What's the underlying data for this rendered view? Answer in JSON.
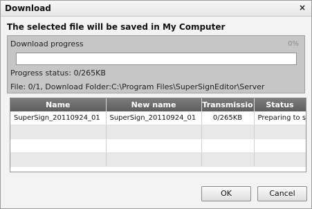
{
  "window": {
    "title": "Download",
    "close_label": "×"
  },
  "subtitle": "The selected file will be saved in My Computer",
  "progress": {
    "label": "Download progress",
    "percent_text": "0%",
    "fraction": 0,
    "status": "Progress status: 0/265KB",
    "file_info": "File: 0/1,  Download Folder:C:\\Program Files\\SuperSignEditor\\Server"
  },
  "table": {
    "columns": [
      "Name",
      "New name",
      "Transmissio",
      "Status"
    ],
    "rows": [
      [
        "SuperSign_20110924_01",
        "SuperSign_20110924_01",
        "0/265KB",
        "Preparing to se"
      ]
    ]
  },
  "buttons": {
    "ok": "OK",
    "cancel": "Cancel"
  },
  "colors": {
    "header_bg": "#6e6e6e",
    "panel_bg": "#c6c6c6"
  }
}
